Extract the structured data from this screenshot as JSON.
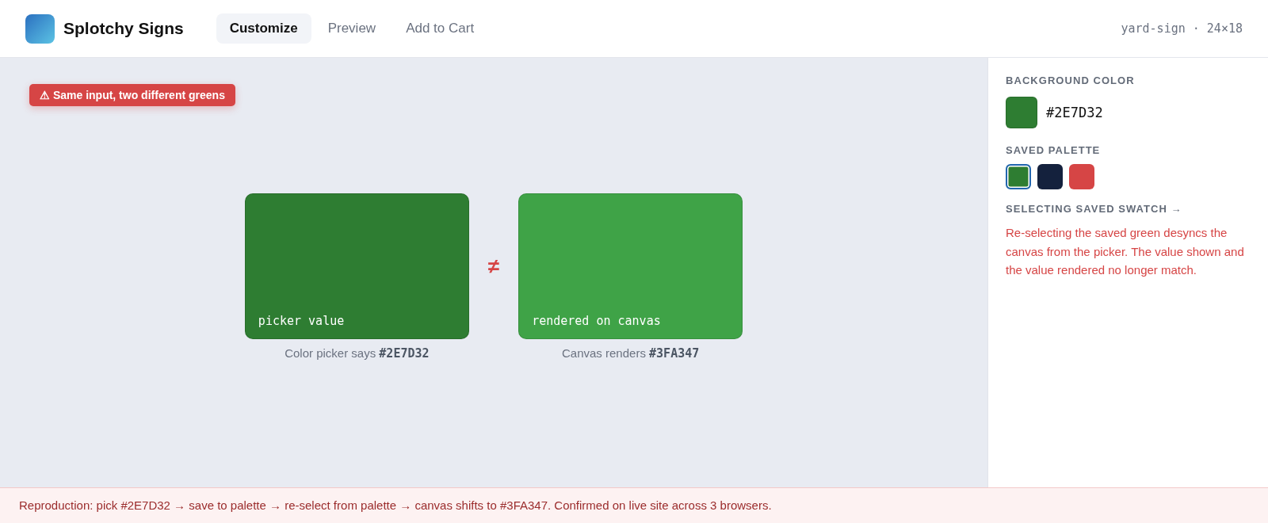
{
  "header": {
    "title": "Splotchy Signs",
    "tabs": [
      {
        "label": "Customize",
        "selected": true
      },
      {
        "label": "Preview",
        "selected": false
      },
      {
        "label": "Add to Cart",
        "selected": false
      }
    ],
    "product": "yard-sign · 24×18"
  },
  "workspace": {
    "badge": "⚠ Same input, two different greens",
    "samples": [
      {
        "label": "picker value",
        "color": "#2e7d32",
        "caption": "Color picker says **#2E7D32**"
      },
      {
        "label": "rendered on canvas",
        "color": "#3fa347",
        "caption": "Canvas renders **#3FA347**"
      }
    ],
    "separator": "≠"
  },
  "panel": {
    "background_color": {
      "heading": "BACKGROUND COLOR",
      "color": "#2e7d32",
      "value": "#2E7D32"
    },
    "saved_palette": {
      "heading": "SAVED PALETTE",
      "swatches": [
        {
          "color": "#2e7d32",
          "selected": true
        },
        {
          "color": "#14213d",
          "selected": false
        },
        {
          "color": "#d64545",
          "selected": false
        }
      ]
    },
    "note": {
      "heading": "SELECTING SAVED SWATCH →",
      "text": "Re-selecting the saved green desyncs the canvas from the picker. The value shown and the value rendered no longer match."
    }
  },
  "footer": {
    "text": "Reproduction: pick #2E7D32 → save to palette → re-select from palette → canvas shifts to #3FA347. Confirmed on live site across 3 browsers."
  }
}
